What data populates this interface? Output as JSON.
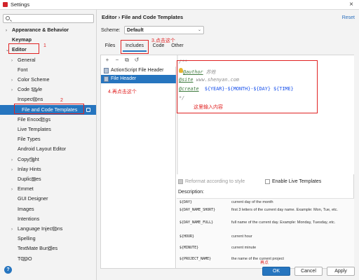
{
  "window": {
    "title": "Settings"
  },
  "breadcrumb": {
    "part1": "Editor",
    "sep": "›",
    "part2": "File and Code Templates"
  },
  "reset_label": "Reset",
  "scheme": {
    "label": "Scheme:",
    "value": "Default"
  },
  "tabs": [
    "Files",
    "Includes",
    "Code",
    "Other"
  ],
  "sidebar": {
    "items": [
      {
        "label": "Appearance & Behavior",
        "arrow": "›"
      },
      {
        "label": "Keymap",
        "arrow": ""
      },
      {
        "label": "Editor",
        "arrow": "⌄"
      },
      {
        "label": "General",
        "arrow": "›"
      },
      {
        "label": "Font",
        "arrow": ""
      },
      {
        "label": "Color Scheme",
        "arrow": "›"
      },
      {
        "label": "Code Style",
        "arrow": "›"
      },
      {
        "label": "Inspections",
        "arrow": ""
      },
      {
        "label": "File and Code Templates",
        "arrow": ""
      },
      {
        "label": "File Encodings",
        "arrow": ""
      },
      {
        "label": "Live Templates",
        "arrow": ""
      },
      {
        "label": "File Types",
        "arrow": ""
      },
      {
        "label": "Android Layout Editor",
        "arrow": ""
      },
      {
        "label": "Copyright",
        "arrow": "›"
      },
      {
        "label": "Inlay Hints",
        "arrow": "›"
      },
      {
        "label": "Duplicates",
        "arrow": ""
      },
      {
        "label": "Emmet",
        "arrow": "›"
      },
      {
        "label": "GUI Designer",
        "arrow": ""
      },
      {
        "label": "Images",
        "arrow": ""
      },
      {
        "label": "Intentions",
        "arrow": ""
      },
      {
        "label": "Language Injections",
        "arrow": "›"
      },
      {
        "label": "Spelling",
        "arrow": ""
      },
      {
        "label": "TextMate Bundles",
        "arrow": ""
      },
      {
        "label": "TODO",
        "arrow": ""
      }
    ]
  },
  "toolbar": {
    "add": "+",
    "remove": "−",
    "copy": "⧉",
    "reset": "↺"
  },
  "templates": [
    "ActionScript File Header",
    "File Header"
  ],
  "code_lines": {
    "line1": "/**",
    "author_tag": "@author",
    "author_val": "苏他",
    "site_tag": "@site",
    "site_val": "www.shenyan.com",
    "create_tag": "@create",
    "create_val": "${YEAR}-${MONTH}-${DAY} ${TIME}",
    "line5": "*/"
  },
  "options": {
    "reformat": "Reformat according to style",
    "live": "Enable Live Templates"
  },
  "description": {
    "label": "Description:",
    "rows": [
      {
        "key": "${DAY}",
        "val": "current day of the month"
      },
      {
        "key": "${DAY_NAME_SHORT}",
        "val": "first 3 letters of the current day name. Example: Mon, Tue, etc."
      },
      {
        "key": "${DAY_NAME_FULL}",
        "val": "full name of the current day. Example: Monday, Tuesday, etc."
      },
      {
        "key": "${HOUR}",
        "val": "current hour"
      },
      {
        "key": "${MINUTE}",
        "val": "current minute"
      },
      {
        "key": "${PROJECT_NAME}",
        "val": "the name of the current project"
      }
    ]
  },
  "buttons": {
    "help": "?",
    "ok": "OK",
    "cancel": "Cancel",
    "apply": "Apply"
  },
  "annotations": {
    "n1": "1",
    "n2": "2",
    "n3": "3.点击这个",
    "n4": "4.再点击这个",
    "n5": "这里输入内容",
    "n6": "再点"
  },
  "colors": {
    "accent": "#2675bf",
    "annotation": "#e02222"
  }
}
